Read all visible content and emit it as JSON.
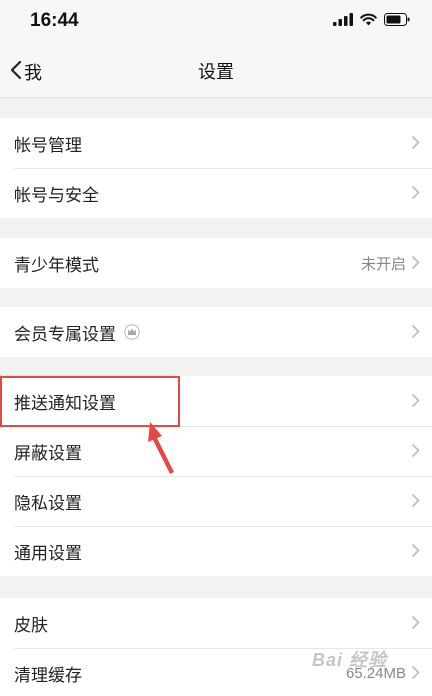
{
  "status_bar": {
    "time": "16:44"
  },
  "nav": {
    "back_label": "我",
    "title": "设置"
  },
  "groups": [
    {
      "items": [
        {
          "label": "帐号管理"
        },
        {
          "label": "帐号与安全"
        }
      ]
    },
    {
      "items": [
        {
          "label": "青少年模式",
          "value": "未开启"
        }
      ]
    },
    {
      "items": [
        {
          "label": "会员专属设置",
          "icon": "crown-icon"
        }
      ]
    },
    {
      "items": [
        {
          "label": "推送通知设置"
        },
        {
          "label": "屏蔽设置"
        },
        {
          "label": "隐私设置"
        },
        {
          "label": "通用设置"
        }
      ]
    },
    {
      "items": [
        {
          "label": "皮肤"
        },
        {
          "label": "清理缓存",
          "value": "65.24MB"
        }
      ]
    }
  ],
  "watermark": "Bai 经验",
  "colors": {
    "highlight": "#e24a43",
    "background": "#f2f2f2",
    "row_bg": "#ffffff"
  }
}
